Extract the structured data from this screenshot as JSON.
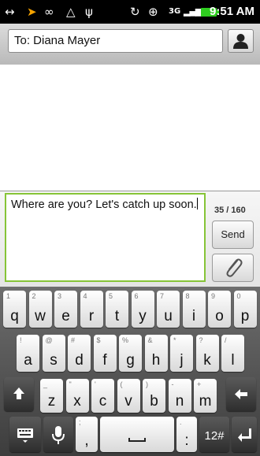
{
  "status_bar": {
    "time": "9:51 AM",
    "network": "3G"
  },
  "header": {
    "recipient": "To: Diana Mayer"
  },
  "compose": {
    "message": "Where are you? Let's catch up soon.",
    "char_count": "35 / 160",
    "send_label": "Send"
  },
  "keyboard": {
    "row1": [
      {
        "sub": "1",
        "main": "q"
      },
      {
        "sub": "2",
        "main": "w"
      },
      {
        "sub": "3",
        "main": "e"
      },
      {
        "sub": "4",
        "main": "r"
      },
      {
        "sub": "5",
        "main": "t"
      },
      {
        "sub": "6",
        "main": "y"
      },
      {
        "sub": "7",
        "main": "u"
      },
      {
        "sub": "8",
        "main": "i"
      },
      {
        "sub": "9",
        "main": "o"
      },
      {
        "sub": "0",
        "main": "p"
      }
    ],
    "row2": [
      {
        "sub": "!",
        "main": "a"
      },
      {
        "sub": "@",
        "main": "s"
      },
      {
        "sub": "#",
        "main": "d"
      },
      {
        "sub": "$",
        "main": "f"
      },
      {
        "sub": "%",
        "main": "g"
      },
      {
        "sub": "&",
        "main": "h"
      },
      {
        "sub": "*",
        "main": "j"
      },
      {
        "sub": "?",
        "main": "k"
      },
      {
        "sub": "/",
        "main": "l"
      }
    ],
    "row3": [
      {
        "sub": "_",
        "main": "z"
      },
      {
        "sub": "\"",
        "main": "x"
      },
      {
        "sub": "'",
        "main": "c"
      },
      {
        "sub": "(",
        "main": "v"
      },
      {
        "sub": ")",
        "main": "b"
      },
      {
        "sub": "-",
        "main": "n"
      },
      {
        "sub": "+",
        "main": "m"
      }
    ],
    "symbols_label": "12#",
    "punct_label": ",",
    "punct2_label": ":"
  }
}
